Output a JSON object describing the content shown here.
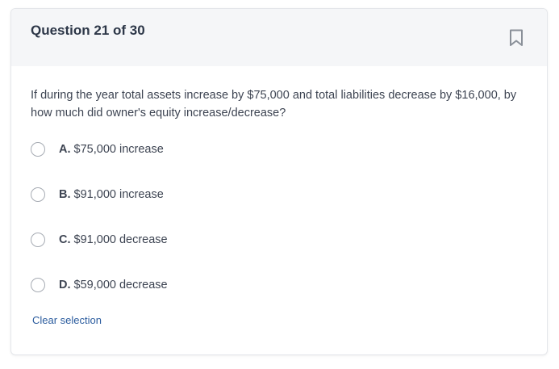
{
  "header": {
    "title": "Question 21 of 30"
  },
  "question": {
    "text": "If during the year total assets increase by $75,000 and total liabilities decrease by $16,000, by how much did owner's equity increase/decrease?"
  },
  "options": [
    {
      "letter": "A.",
      "text": "$75,000 increase"
    },
    {
      "letter": "B.",
      "text": "$91,000 increase"
    },
    {
      "letter": "C.",
      "text": "$91,000 decrease"
    },
    {
      "letter": "D.",
      "text": "$59,000 decrease"
    }
  ],
  "actions": {
    "clear_label": "Clear selection"
  },
  "icons": {
    "bookmark": "bookmark-icon",
    "radio": "radio-unchecked-icon"
  },
  "colors": {
    "header_bg": "#f5f6f8",
    "link": "#2b5c9e",
    "icon_gray": "#8a9099"
  }
}
